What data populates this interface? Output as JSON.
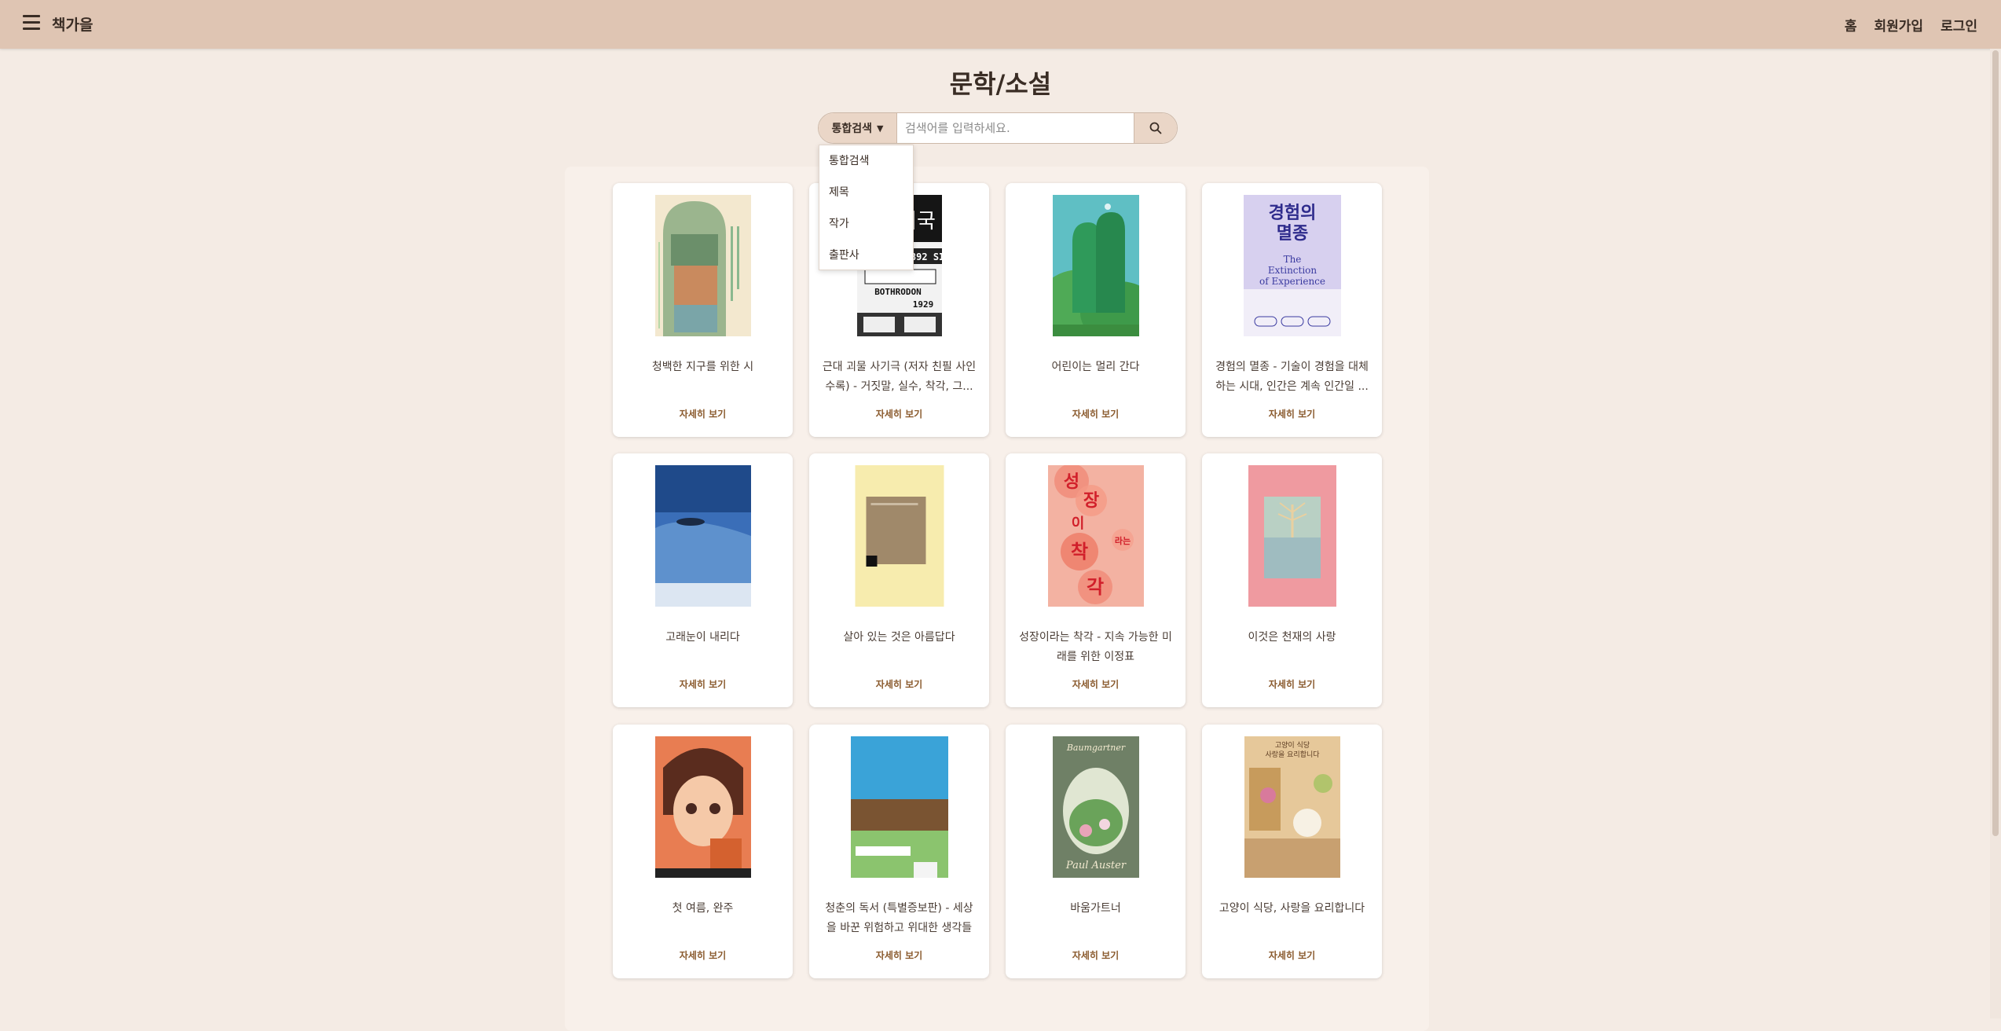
{
  "header": {
    "brand": "책가을",
    "nav": [
      "홈",
      "회원가입",
      "로그인"
    ]
  },
  "page_title": "문학/소설",
  "search": {
    "type_label": "통합검색",
    "placeholder": "검색어를 입력하세요.",
    "options": [
      "통합검색",
      "제목",
      "작가",
      "출판사"
    ]
  },
  "books": [
    {
      "title": "청백한 지구를 위한 시",
      "detail": "자세히 보기"
    },
    {
      "title": "근대 괴물 사기극 (저자 친필 사인 수록) - 거짓말, 실수, 착각, 그...",
      "detail": "자세히 보기"
    },
    {
      "title": "어린이는 멀리 간다",
      "detail": "자세히 보기"
    },
    {
      "title": "경험의 멸종 - 기술이 경험을 대체하는 시대, 인간은 계속 인간일 ...",
      "detail": "자세히 보기"
    },
    {
      "title": "고래눈이 내리다",
      "detail": "자세히 보기"
    },
    {
      "title": "살아 있는 것은 아름답다",
      "detail": "자세히 보기"
    },
    {
      "title": "성장이라는 착각 - 지속 가능한 미래를 위한 이정표",
      "detail": "자세히 보기"
    },
    {
      "title": "이것은 천재의 사랑",
      "detail": "자세히 보기"
    },
    {
      "title": "첫 여름, 완주",
      "detail": "자세히 보기"
    },
    {
      "title": "청춘의 독서 (특별증보판) - 세상을 바꾼 위험하고 위대한 생각들",
      "detail": "자세히 보기"
    },
    {
      "title": "바움가트너",
      "detail": "자세히 보기"
    },
    {
      "title": "고양이 식당, 사랑을 요리합니다",
      "detail": "자세히 보기"
    }
  ],
  "cover_text": {
    "book2": [
      "기국",
      "1892 SI",
      "BOTHRODON",
      "1929"
    ],
    "book4": [
      "경험의",
      "멸종",
      "The",
      "Extinction",
      "of Experience"
    ],
    "book7": [
      "성",
      "장",
      "이",
      "라는",
      "착",
      "각"
    ],
    "book11": [
      "Baumgartner",
      "Paul Auster"
    ],
    "book12": [
      "고양이 식당",
      "사랑을 요리합니다"
    ]
  },
  "colors": {
    "header": "#dfc5b3",
    "background": "#f4ebe4",
    "accent": "#8a5a2d"
  }
}
